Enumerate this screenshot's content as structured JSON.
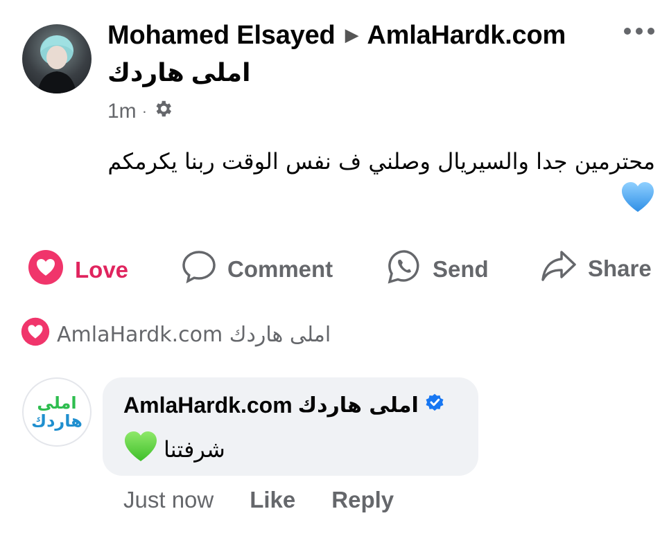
{
  "post": {
    "author": "Mohamed Elsayed",
    "target_page": "AmlaHardk.com",
    "group_name_ar": "املى هاردك",
    "time": "1m",
    "body": "محترمين جدا والسيريال وصلني ف نفس الوقت ربنا يكرمكم"
  },
  "actions": {
    "love": "Love",
    "comment": "Comment",
    "send": "Send",
    "share": "Share"
  },
  "reactions": {
    "reactor_name": "املى هاردك AmlaHardk.com"
  },
  "comment": {
    "author_en": "AmlaHardk.com",
    "author_ar": "املى هاردك",
    "text": "شرفتنا",
    "avatar_line1": "املى",
    "avatar_line2": "هاردك",
    "time": "Just now",
    "like": "Like",
    "reply": "Reply"
  },
  "colors": {
    "love": "#e0245e",
    "muted": "#65676b",
    "verified": "#1877f2",
    "bubble": "#f0f2f5"
  },
  "icons": [
    "settings-gear-icon",
    "more-options-icon",
    "heart-icon",
    "comment-bubble-icon",
    "whatsapp-send-icon",
    "share-arrow-icon",
    "verified-badge-icon",
    "blue-heart-emoji",
    "green-heart-emoji"
  ]
}
